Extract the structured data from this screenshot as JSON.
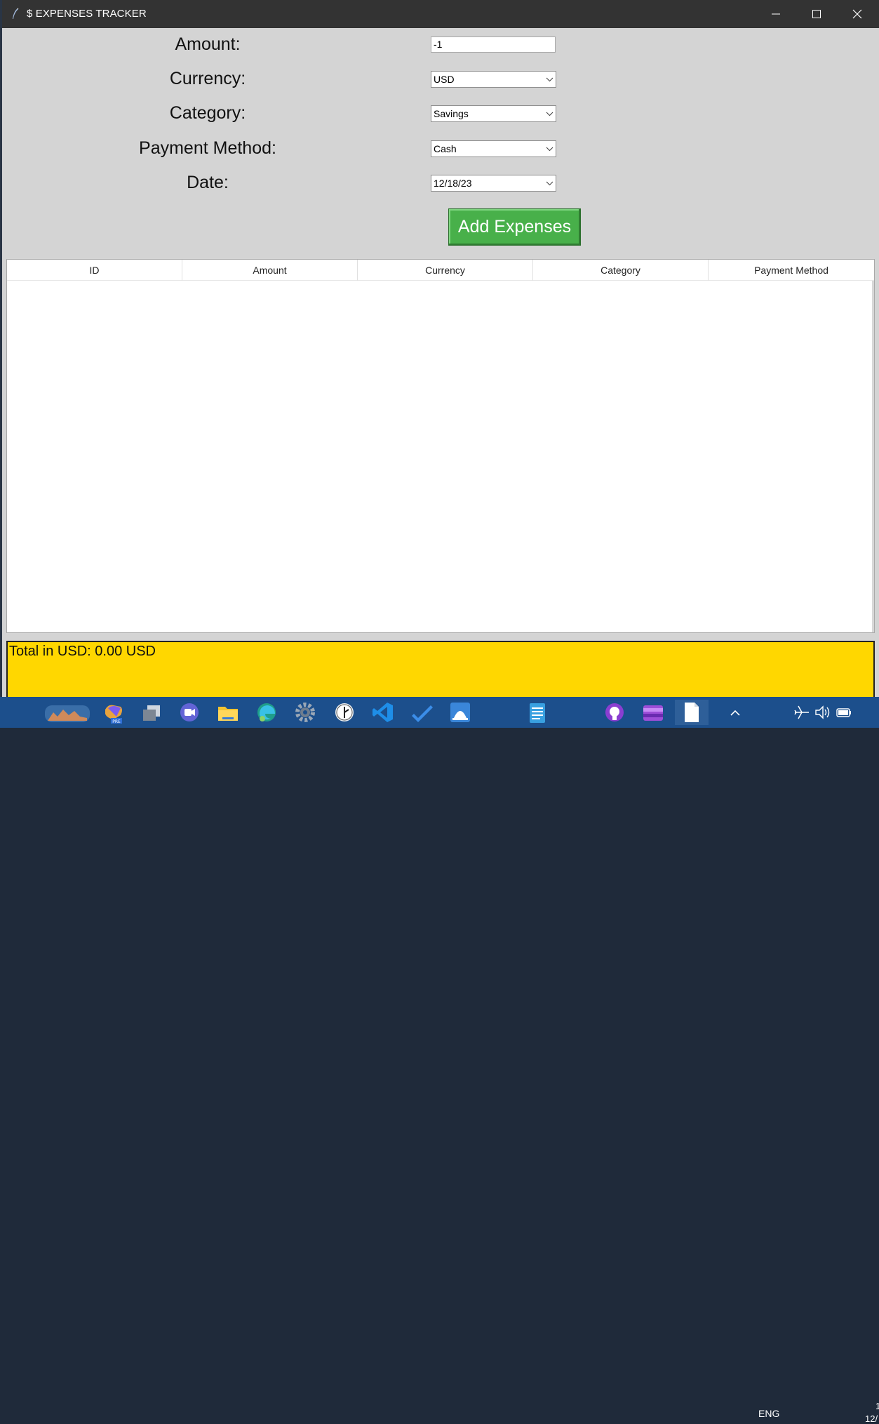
{
  "window": {
    "title": "$ EXPENSES TRACKER"
  },
  "form": {
    "amount_label": "Amount:",
    "amount_value": "-1",
    "currency_label": "Currency:",
    "currency_value": "USD",
    "category_label": "Category:",
    "category_value": "Savings",
    "payment_label": "Payment Method:",
    "payment_value": "Cash",
    "date_label": "Date:",
    "date_value": "12/18/23",
    "add_button": "Add Expenses"
  },
  "table": {
    "columns": [
      "ID",
      "Amount",
      "Currency",
      "Category",
      "Payment Method"
    ],
    "rows": []
  },
  "total": {
    "text": "Total in USD: 0.00 USD"
  },
  "colors": {
    "title_bar": "#333333",
    "window_bg": "#d4d4d4",
    "add_button": "#48b04a",
    "total_bg": "#ffd700",
    "taskbar": "#1c4f8c"
  },
  "taskbar": {
    "language": "ENG",
    "clock_partial_1": "1",
    "clock_partial_2": "12/",
    "icons": [
      "widgets-icon",
      "copilot-icon",
      "task-view-icon",
      "teams-icon",
      "file-explorer-icon",
      "edge-icon",
      "settings-icon",
      "clock-icon",
      "vscode-icon",
      "todo-icon",
      "app-icon",
      "notepad-icon",
      "github-icon",
      "clipchamp-icon",
      "file-icon"
    ]
  }
}
